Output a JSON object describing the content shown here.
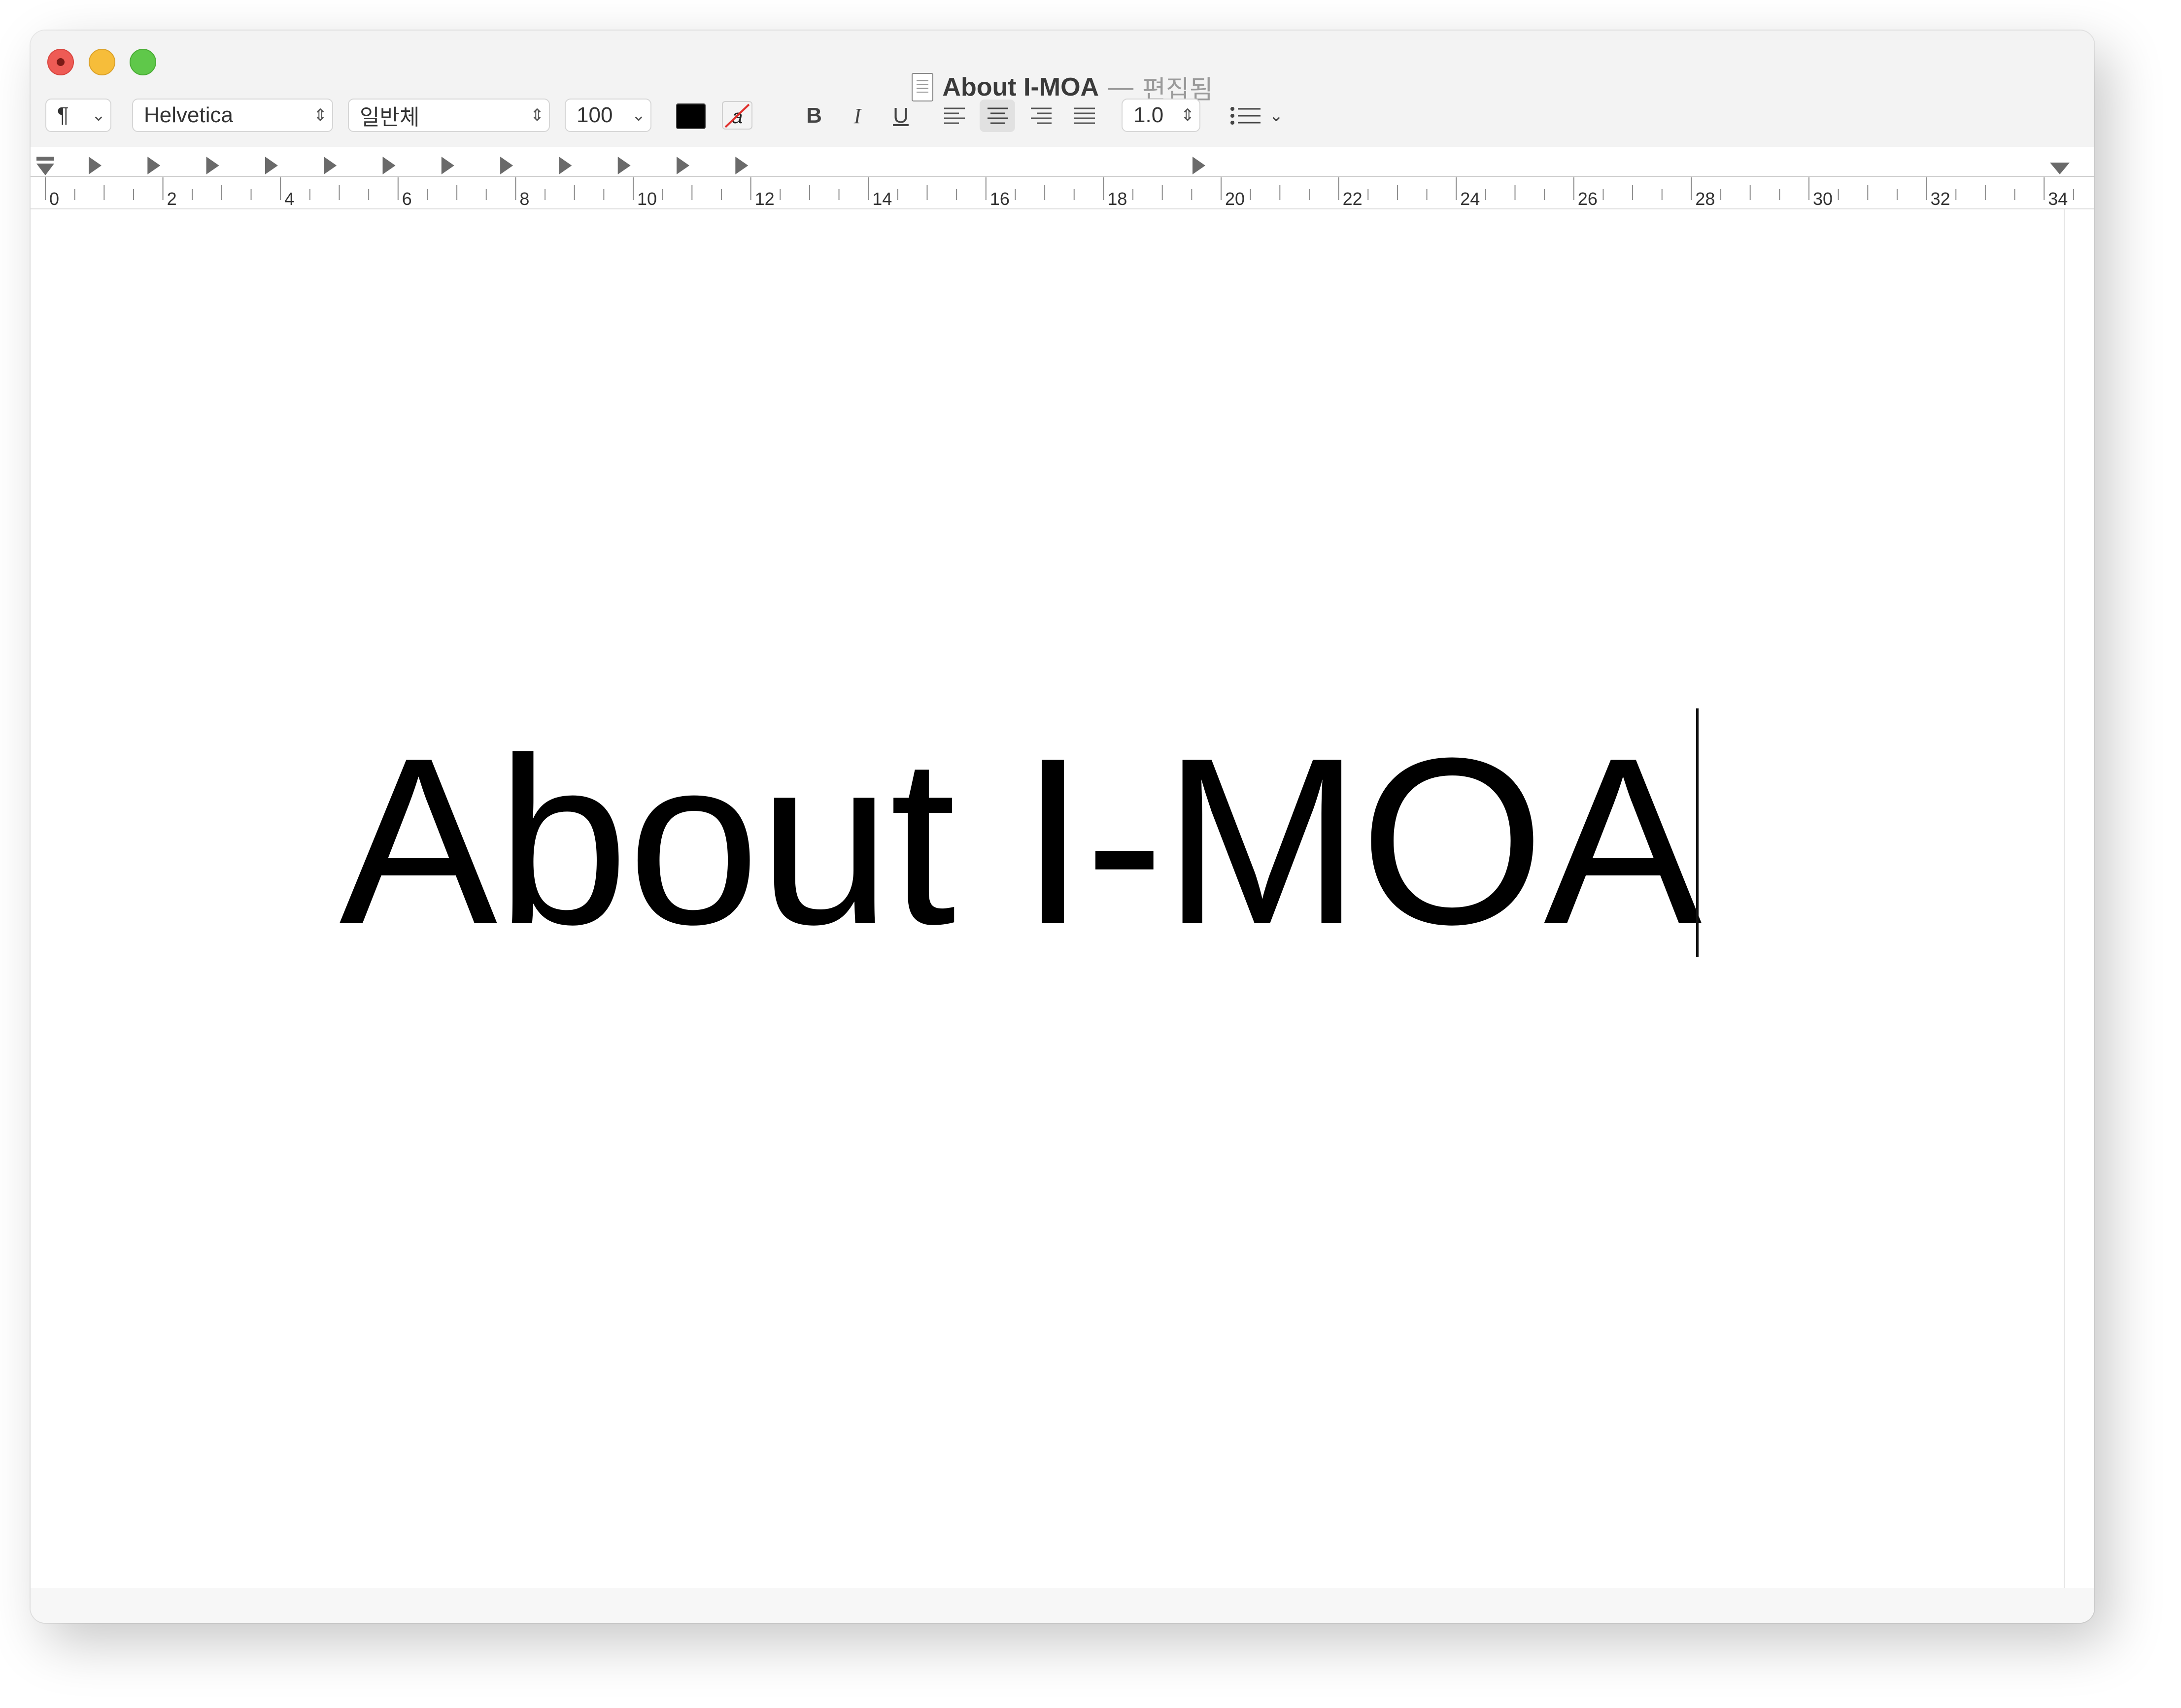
{
  "window": {
    "title": "About I-MOA",
    "title_separator": "—",
    "title_status": "편집됨"
  },
  "toolbar": {
    "paragraph_style": "¶",
    "font_family": "Helvetica",
    "font_style": "일반체",
    "font_size": "100",
    "bold": "B",
    "italic": "I",
    "underline": "U",
    "line_spacing": "1.0",
    "text_color": "#000000"
  },
  "ruler": {
    "labels": [
      "0",
      "2",
      "4",
      "6",
      "8",
      "10",
      "12",
      "14",
      "16",
      "18",
      "20",
      "22",
      "24",
      "26",
      "28",
      "30",
      "32",
      "34"
    ]
  },
  "document": {
    "text": "About I-MOA"
  },
  "icons": {
    "close": "close-window-icon",
    "minimize": "minimize-window-icon",
    "maximize": "maximize-window-icon",
    "document": "document-icon",
    "highlight": "highlight-color-icon",
    "list": "list-bullets-icon"
  }
}
